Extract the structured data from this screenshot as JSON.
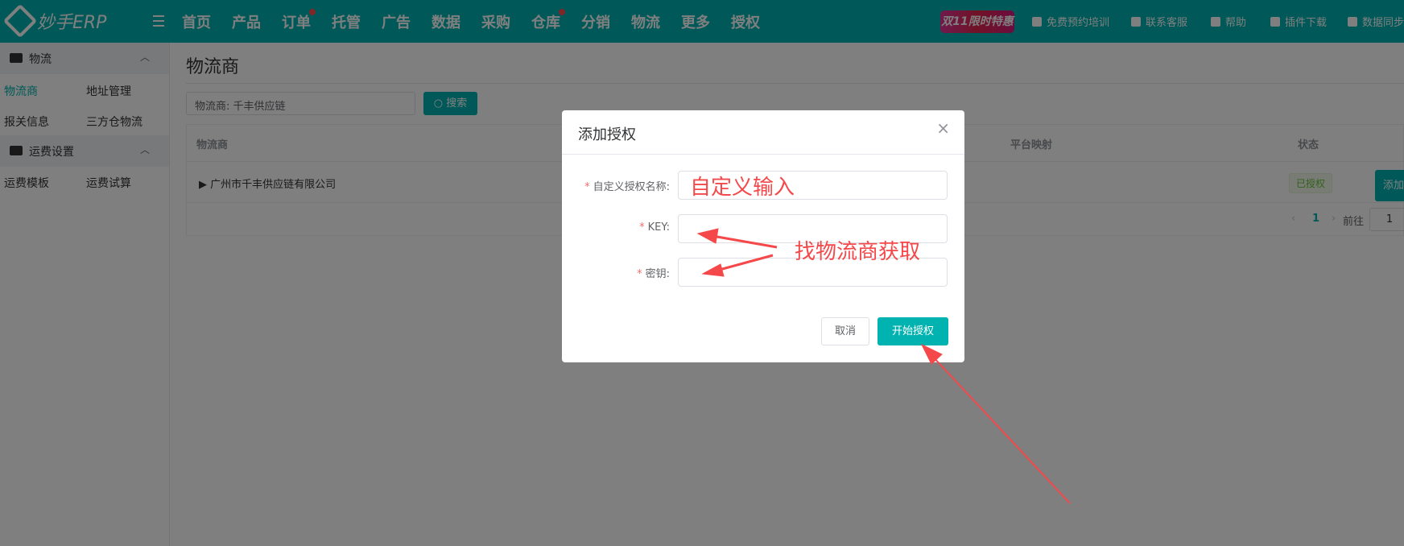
{
  "topbar": {
    "logo": "妙手ERP",
    "nav": [
      {
        "label": "首页"
      },
      {
        "label": "产品"
      },
      {
        "label": "订单",
        "dot": true
      },
      {
        "label": "托管"
      },
      {
        "label": "广告"
      },
      {
        "label": "数据"
      },
      {
        "label": "采购"
      },
      {
        "label": "仓库",
        "dot": true
      },
      {
        "label": "分销"
      },
      {
        "label": "物流"
      },
      {
        "label": "更多"
      },
      {
        "label": "授权"
      }
    ],
    "promo": "双11限时特惠",
    "right": [
      {
        "label": "免费预约培训",
        "icon": "monitor-icon"
      },
      {
        "label": "联系客服",
        "icon": "chat-icon"
      },
      {
        "label": "帮助",
        "icon": "help-icon"
      },
      {
        "label": "插件下载",
        "icon": "download-icon"
      },
      {
        "label": "数据同步",
        "icon": "sync-icon"
      }
    ]
  },
  "sidebar": {
    "sections": [
      {
        "title": "物流",
        "items": [
          "物流商",
          "地址管理",
          "报关信息",
          "三方仓物流"
        ]
      },
      {
        "title": "运费设置",
        "items": [
          "运费模板",
          "运费试算"
        ]
      }
    ]
  },
  "main": {
    "title": "物流商",
    "search_value": "物流商:   千丰供应链",
    "search_button": "搜索",
    "columns": [
      "物流商",
      "平台映射",
      "状态"
    ],
    "row": {
      "name": "▶ 广州市千丰供应链有限公司",
      "status": "已授权",
      "action": "添加"
    },
    "pagination": {
      "current": "1",
      "goto_label": "前往",
      "goto_value": "1"
    }
  },
  "modal": {
    "title": "添加授权",
    "fields": [
      {
        "label": "自定义授权名称:"
      },
      {
        "label": "KEY:"
      },
      {
        "label": "密钥:"
      }
    ],
    "cancel": "取消",
    "submit": "开始授权"
  },
  "annotations": {
    "custom_input": "自定义输入",
    "get_from_provider": "找物流商获取"
  },
  "colors": {
    "accent": "#00b3b0",
    "annotation": "#f5484a"
  }
}
